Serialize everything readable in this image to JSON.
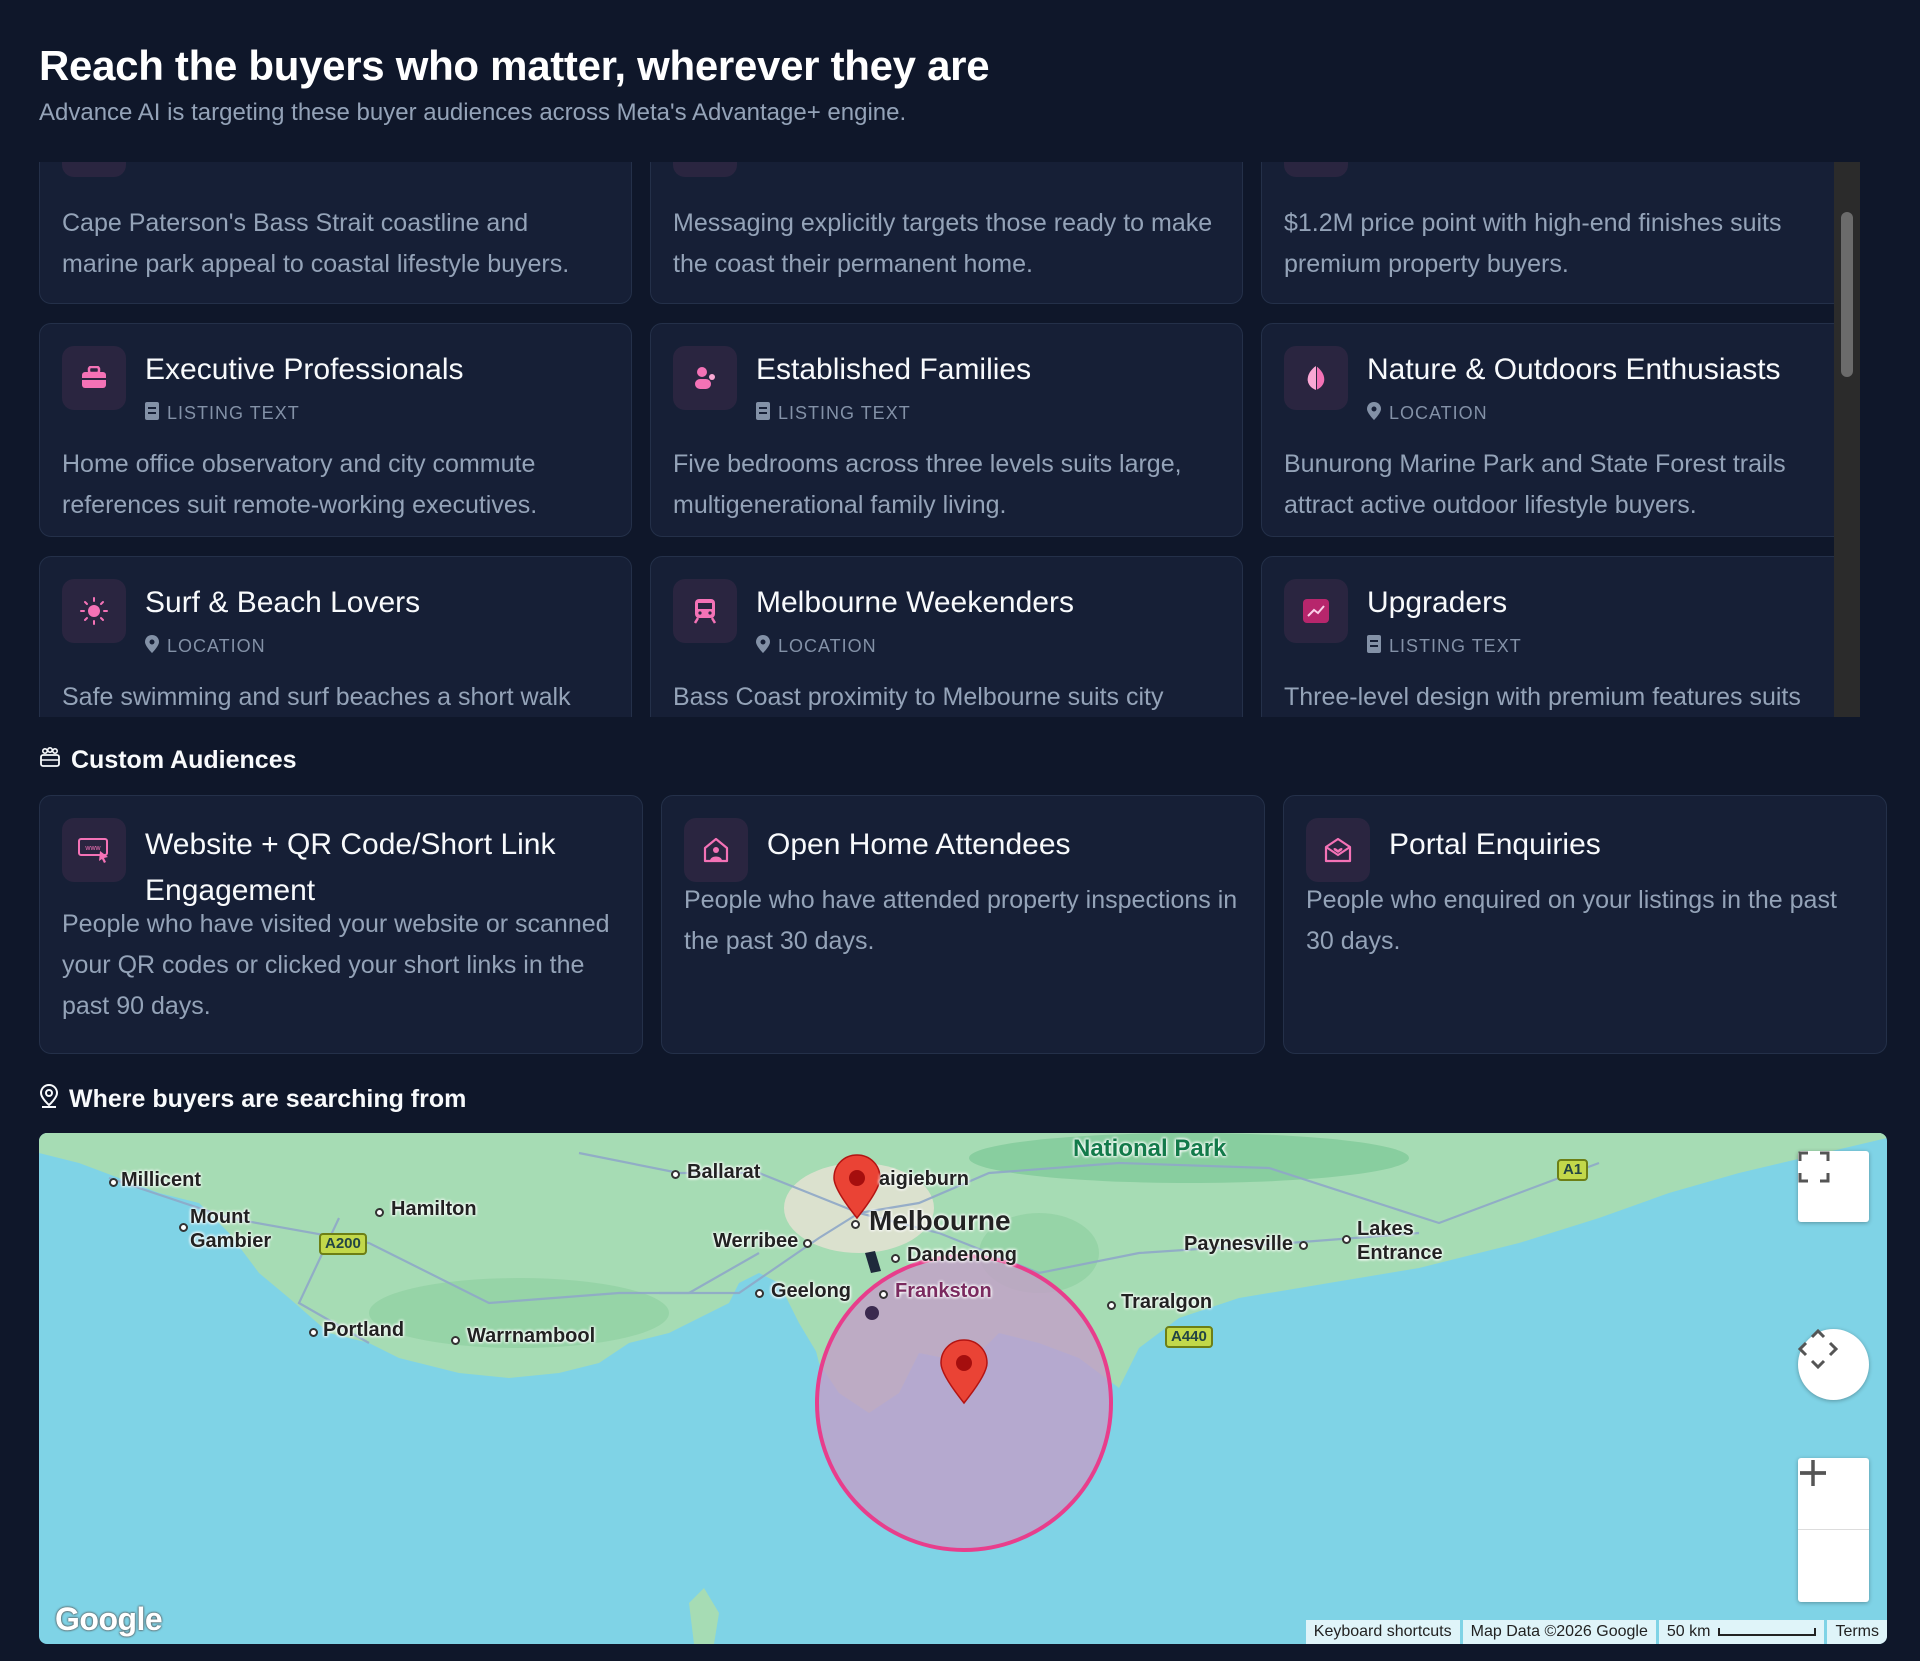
{
  "header": {
    "title": "Reach the buyers who matter, wherever they are",
    "subtitle": "Advance AI is targeting these buyer audiences across Meta's Advantage+ engine."
  },
  "audiences": [
    {
      "title": "",
      "tag": "",
      "desc": "Cape Paterson's Bass Strait coastline and marine park appeal to coastal lifestyle buyers.",
      "icon": "wave-icon"
    },
    {
      "title": "",
      "tag": "",
      "desc": "Messaging explicitly targets those ready to make the coast their permanent home.",
      "icon": "home-icon"
    },
    {
      "title": "",
      "tag": "",
      "desc": "$1.2M price point with high-end finishes suits premium property buyers.",
      "icon": "diamond-icon"
    },
    {
      "title": "Executive Professionals",
      "tag": "LISTING TEXT",
      "tag_icon": "document-icon",
      "desc": "Home office observatory and city commute references suit remote-working executives.",
      "icon": "briefcase-icon"
    },
    {
      "title": "Established Families",
      "tag": "LISTING TEXT",
      "tag_icon": "document-icon",
      "desc": "Five bedrooms across three levels suits large, multigenerational family living.",
      "icon": "people-icon"
    },
    {
      "title": "Nature & Outdoors Enthusiasts",
      "tag": "LOCATION",
      "tag_icon": "location-pin-icon",
      "desc": "Bunurong Marine Park and State Forest trails attract active outdoor lifestyle buyers.",
      "icon": "leaf-icon"
    },
    {
      "title": "Surf & Beach Lovers",
      "tag": "LOCATION",
      "tag_icon": "location-pin-icon",
      "desc": "Safe swimming and surf beaches a short walk away appeal to beach-loving buyers.",
      "icon": "sun-icon"
    },
    {
      "title": "Melbourne Weekenders",
      "tag": "LOCATION",
      "tag_icon": "location-pin-icon",
      "desc": "Bass Coast proximity to Melbourne suits city buyers seeking a permanent escape.",
      "icon": "train-icon"
    },
    {
      "title": "Upgraders",
      "tag": "LISTING TEXT",
      "tag_icon": "document-icon",
      "desc": "Three-level design with premium features suits buyers upsizing from smaller homes.",
      "icon": "trend-up-icon"
    }
  ],
  "custom_section": {
    "label": "Custom Audiences",
    "icon": "group-icon",
    "cards": [
      {
        "title": "Website + QR Code/Short Link Engagement",
        "desc": "People who have visited your website or scanned your QR codes or clicked your short links in the past 90 days.",
        "icon": "web-click-icon"
      },
      {
        "title": "Open Home Attendees",
        "desc": "People who have attended property inspections in the past 30 days.",
        "icon": "house-person-icon"
      },
      {
        "title": "Portal Enquiries",
        "desc": "People who enquired on your listings in the past 30 days.",
        "icon": "mail-heart-icon"
      }
    ]
  },
  "map_section": {
    "label": "Where buyers are searching from",
    "icon": "map-pin-outline-icon",
    "places": {
      "millicent": "Millicent",
      "mount_gambier": "Mount\nGambier",
      "hamilton": "Hamilton",
      "portland": "Portland",
      "warrnambool": "Warrnambool",
      "ballarat": "Ballarat",
      "craigieburn": "aigieburn",
      "melbourne": "Melbourne",
      "werribee": "Werribee",
      "geelong": "Geelong",
      "frankston": "Frankston",
      "dandenong": "Dandenong",
      "traralgon": "Traralgon",
      "paynesville": "Paynesville",
      "lakes_entrance": "Lakes\nEntrance",
      "national_park": "National Park"
    },
    "road_shields": {
      "a200": "A200",
      "a440": "A440",
      "a1": "A1"
    },
    "google_logo": "Google",
    "footer": {
      "shortcuts": "Keyboard shortcuts",
      "map_data": "Map Data ©2026 Google",
      "scale": "50 km",
      "terms": "Terms"
    },
    "colors": {
      "water": "#7fd3e6",
      "land": "#a6dcb4",
      "radius": "#e83e8c"
    }
  }
}
